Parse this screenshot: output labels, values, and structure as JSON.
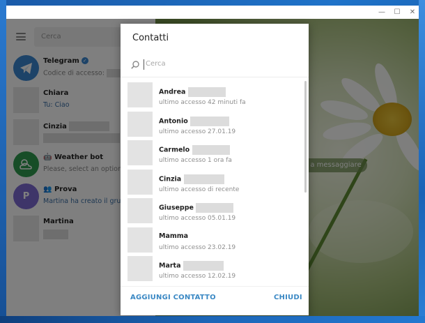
{
  "window": {
    "controls": {
      "minimize": "—",
      "maximize": "☐",
      "close": "✕"
    }
  },
  "sidebar": {
    "search_placeholder": "Cerca",
    "chats": [
      {
        "name": "Telegram",
        "verified": true,
        "preview": "Codice di accesso:",
        "avatar_color": "#3a87d0"
      },
      {
        "name": "Chiara",
        "preview": "Tu: Ciao"
      },
      {
        "name": "Cinzia",
        "preview": ""
      },
      {
        "name": "Weather bot",
        "preview": "Please, select an option fr",
        "avatar_color": "#2e9b4e"
      },
      {
        "name": "Prova",
        "preview": "Martina ha creato il grupp",
        "avatar_color": "#7d6ad3",
        "avatar_letter": "P"
      },
      {
        "name": "Martina",
        "preview": ""
      }
    ]
  },
  "chat_panel": {
    "placeholder_pill": "Seleziona una chat per iniziare a messaggiare",
    "visible_pill_text": "e a messaggiare"
  },
  "dialog": {
    "title": "Contatti",
    "search_placeholder": "Cerca",
    "contacts": [
      {
        "name": "Andrea",
        "status": "ultimo accesso 42 minuti fa"
      },
      {
        "name": "Antonio",
        "status": "ultimo accesso 27.01.19"
      },
      {
        "name": "Carmelo",
        "status": "ultimo accesso 1 ora fa"
      },
      {
        "name": "Cinzia",
        "status": "ultimo accesso di recente"
      },
      {
        "name": "Giuseppe",
        "status": "ultimo accesso 05.01.19"
      },
      {
        "name": "Mamma",
        "status": "ultimo accesso 23.02.19"
      },
      {
        "name": "Marta",
        "status": "ultimo accesso 12.02.19"
      }
    ],
    "add_button": "AGGIUNGI CONTATTO",
    "close_button": "CHIUDI"
  },
  "colors": {
    "accent": "#3a88c4",
    "telegram_blue": "#3a87d0",
    "weather_green": "#2e9b4e",
    "prova_purple": "#7d6ad3"
  }
}
